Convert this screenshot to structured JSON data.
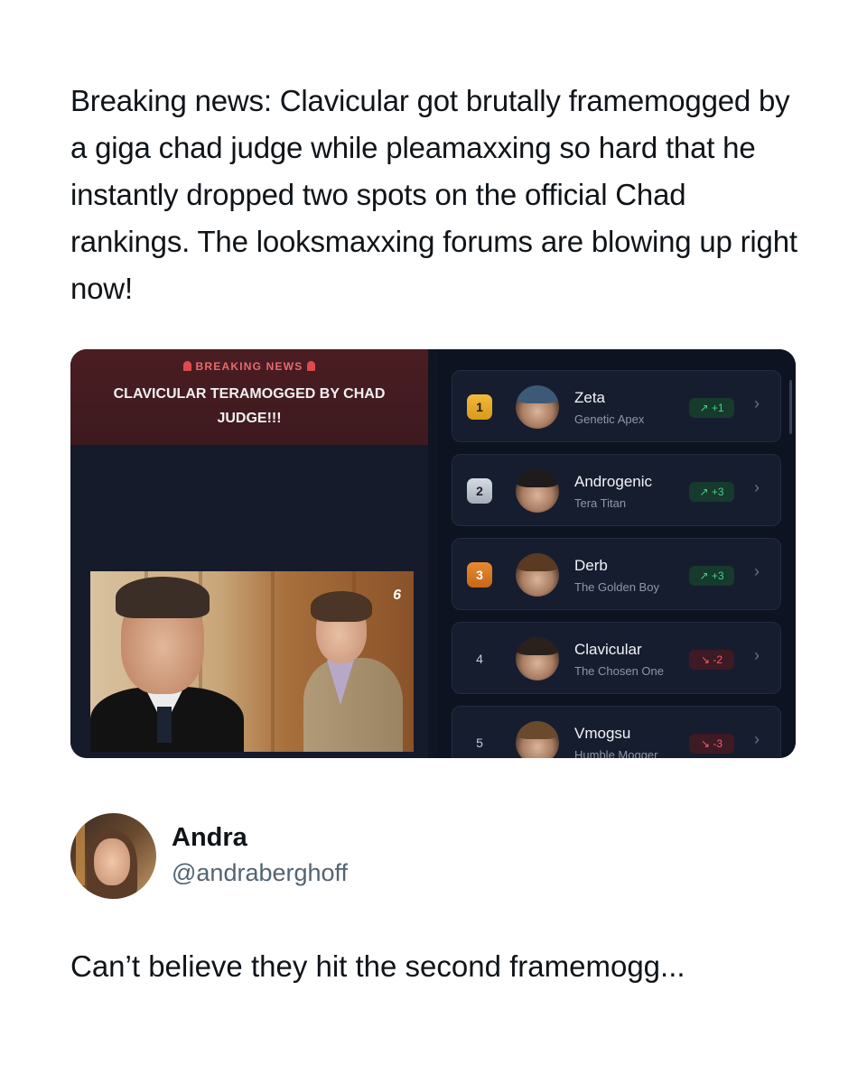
{
  "post": {
    "text": "Breaking news: Clavicular got brutally framemogged by a giga chad judge while pleamaxxing so hard that he instantly dropped two spots on the official Chad rankings. The looksmaxxing forums are blowing up right now!"
  },
  "news_panel": {
    "label": "BREAKING NEWS",
    "headline": "CLAVICULAR TERAMOGGED BY CHAD JUDGE!!!",
    "channel_logo": "6"
  },
  "rankings": [
    {
      "rank": "1",
      "name": "Zeta",
      "title": "Genetic Apex",
      "change": "+1",
      "direction": "up"
    },
    {
      "rank": "2",
      "name": "Androgenic",
      "title": "Tera Titan",
      "change": "+3",
      "direction": "up"
    },
    {
      "rank": "3",
      "name": "Derb",
      "title": "The Golden Boy",
      "change": "+3",
      "direction": "up"
    },
    {
      "rank": "4",
      "name": "Clavicular",
      "title": "The Chosen One",
      "change": "-2",
      "direction": "down"
    },
    {
      "rank": "5",
      "name": "Vmogsu",
      "title": "Humble Mogger",
      "change": "-3",
      "direction": "down"
    }
  ],
  "icons": {
    "trend_up": "trending-up-icon",
    "trend_down": "trending-down-icon",
    "chevron": "chevron-right-icon",
    "siren": "siren-icon"
  },
  "colors": {
    "trend_up": "#3fd48a",
    "trend_down": "#ef5f6f",
    "gold": "#f2b93a",
    "silver": "#c6cbd5",
    "bronze": "#e88a33"
  },
  "author": {
    "name": "Andra",
    "handle": "@andraberghoff"
  },
  "comment": {
    "text": "Can’t believe they hit the second framemogg..."
  }
}
